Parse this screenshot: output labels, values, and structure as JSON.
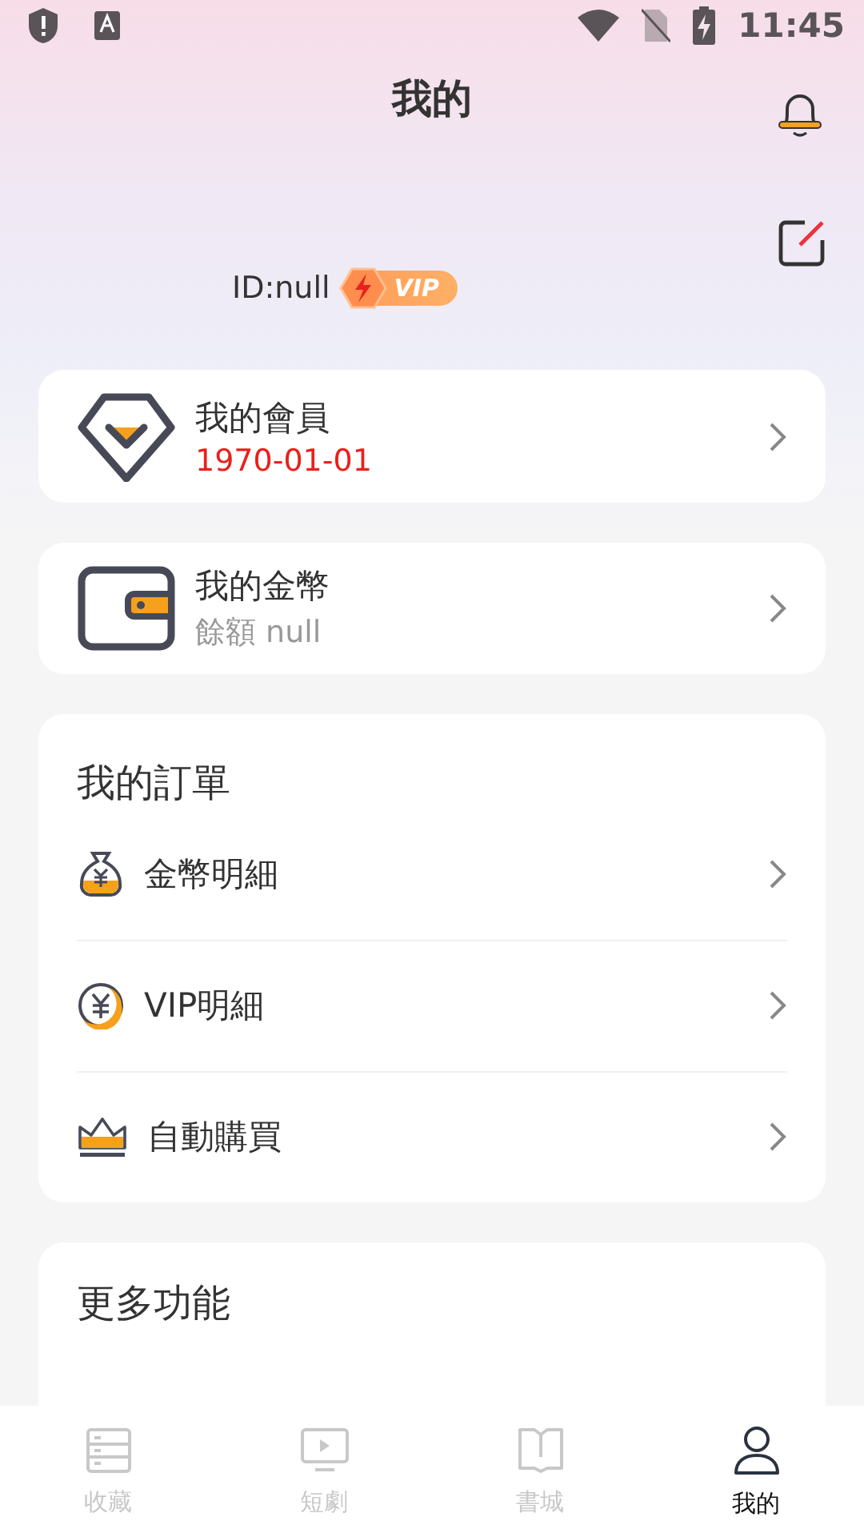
{
  "status_bar": {
    "time": "11:45"
  },
  "header": {
    "title": "我的",
    "user_id": "ID:null",
    "badge": "VIP"
  },
  "cards": [
    {
      "kind": "member",
      "title": "我的會員",
      "subtitle": "1970-01-01"
    },
    {
      "kind": "wallet",
      "title": "我的金幣",
      "subtitle": "餘額 null"
    }
  ],
  "orders": {
    "title": "我的訂單",
    "items": [
      {
        "kind": "coin-bag",
        "label": "金幣明細"
      },
      {
        "kind": "coin",
        "label": "VIP明細"
      },
      {
        "kind": "crown",
        "label": "自動購買"
      }
    ]
  },
  "more": {
    "title": "更多功能"
  },
  "tab_bar": [
    {
      "kind": "list",
      "label": "收藏",
      "selected": false
    },
    {
      "kind": "video",
      "label": "短劇",
      "selected": false
    },
    {
      "kind": "book",
      "label": "書城",
      "selected": false
    },
    {
      "kind": "person",
      "label": "我的",
      "selected": true
    }
  ]
}
